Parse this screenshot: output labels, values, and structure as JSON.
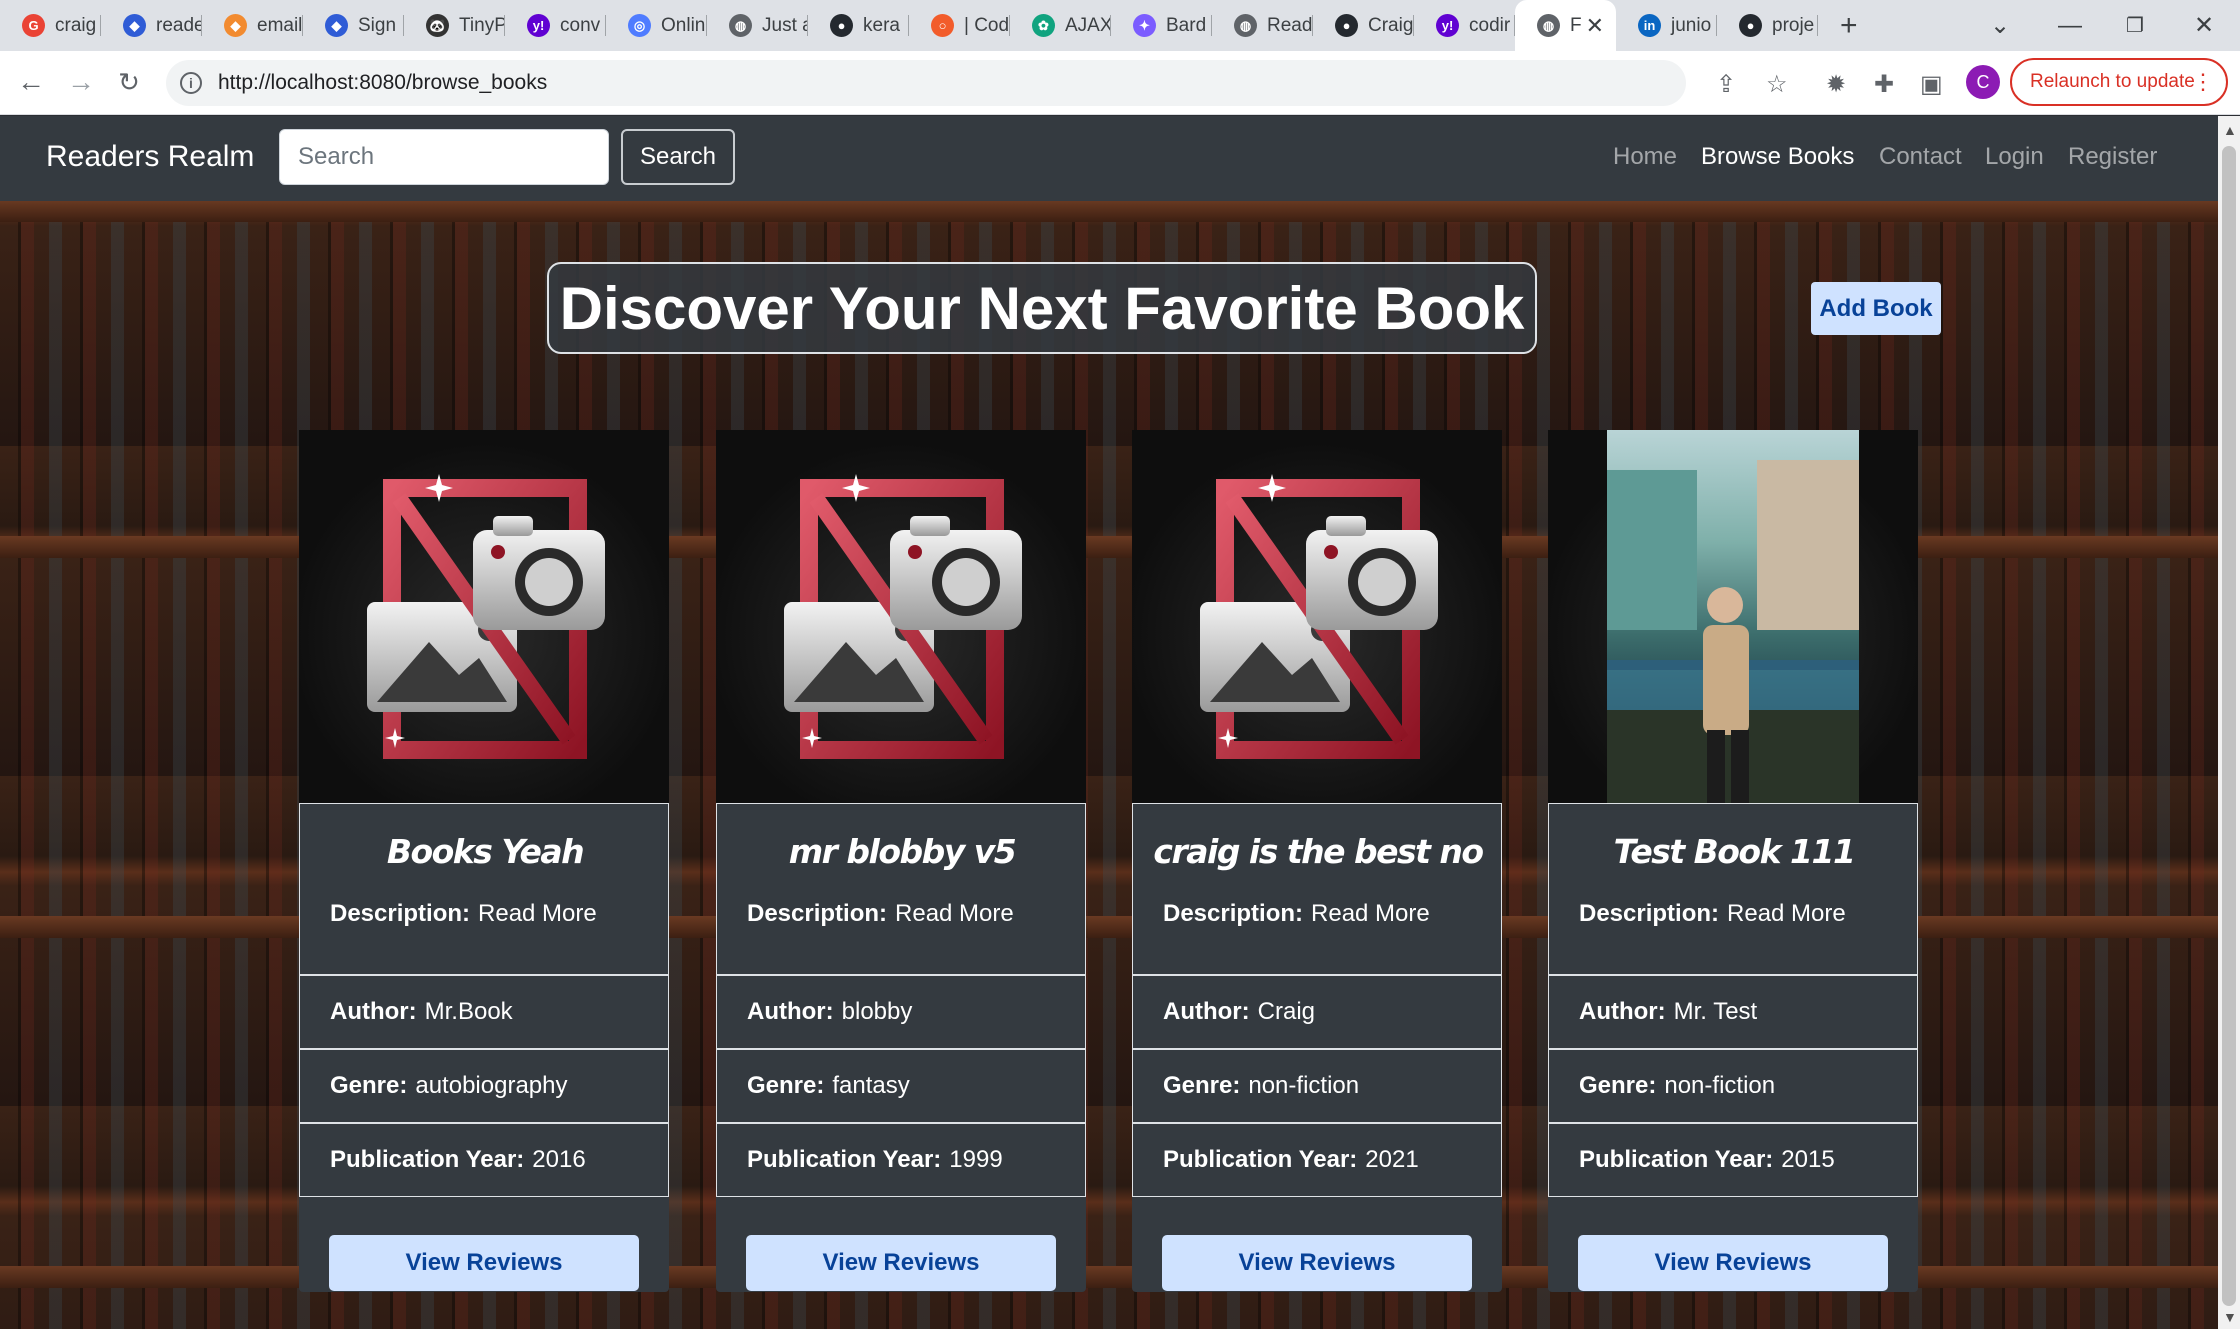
{
  "browser": {
    "tabs": [
      {
        "label": "craig",
        "fav_color": "#ea4335",
        "fav_glyph": "G"
      },
      {
        "label": "reade",
        "fav_color": "#2f5cd6",
        "fav_glyph": "◆"
      },
      {
        "label": "email",
        "fav_color": "#f28b30",
        "fav_glyph": "◆"
      },
      {
        "label": "Sign",
        "fav_color": "#2f5cd6",
        "fav_glyph": "◆"
      },
      {
        "label": "TinyP",
        "fav_color": "#333333",
        "fav_glyph": "🐼"
      },
      {
        "label": "conv",
        "fav_color": "#6001d2",
        "fav_glyph": "y!"
      },
      {
        "label": "Onlin",
        "fav_color": "#4f7cff",
        "fav_glyph": "◎"
      },
      {
        "label": "Just a",
        "fav_color": "#5f6368",
        "fav_glyph": "◍"
      },
      {
        "label": "kera",
        "fav_color": "#24292f",
        "fav_glyph": "●"
      },
      {
        "label": "| Cod",
        "fav_color": "#f25c2b",
        "fav_glyph": "○"
      },
      {
        "label": "AJAX",
        "fav_color": "#10a37f",
        "fav_glyph": "✿"
      },
      {
        "label": "Bard",
        "fav_color": "#7b5cff",
        "fav_glyph": "✦"
      },
      {
        "label": "Read",
        "fav_color": "#5f6368",
        "fav_glyph": "◍"
      },
      {
        "label": "Craig",
        "fav_color": "#24292f",
        "fav_glyph": "●"
      },
      {
        "label": "codir",
        "fav_color": "#6001d2",
        "fav_glyph": "y!"
      },
      {
        "label": "F",
        "fav_color": "#5f6368",
        "fav_glyph": "◍",
        "active": true
      },
      {
        "label": "junio",
        "fav_color": "#0a66c2",
        "fav_glyph": "in"
      },
      {
        "label": "proje",
        "fav_color": "#24292f",
        "fav_glyph": "●"
      }
    ],
    "url": "http://localhost:8080/browse_books",
    "relaunch_label": "Relaunch to update",
    "profile_initial": "C"
  },
  "site": {
    "brand": "Readers Realm",
    "search_placeholder": "Search",
    "search_button": "Search",
    "nav": {
      "home": "Home",
      "browse": "Browse Books",
      "contact": "Contact",
      "login": "Login",
      "register": "Register"
    },
    "hero_title": "Discover Your Next Favorite Book",
    "add_book": "Add Book"
  },
  "labels": {
    "description": "Description:",
    "read_more": "Read More",
    "author": "Author:",
    "genre": "Genre:",
    "year": "Publication Year:",
    "view_reviews": "View Reviews"
  },
  "books": [
    {
      "title": "Books Yeah",
      "author": "Mr.Book",
      "genre": "autobiography",
      "year": "2016",
      "image": "no-image-placeholder"
    },
    {
      "title": "mr blobby v5",
      "author": "blobby",
      "genre": "fantasy",
      "year": "1999",
      "image": "no-image-placeholder"
    },
    {
      "title": "craig is the best no",
      "author": "Craig",
      "genre": "non-fiction",
      "year": "2021",
      "image": "no-image-placeholder"
    },
    {
      "title": "Test Book 111",
      "author": "Mr. Test",
      "genre": "non-fiction",
      "year": "2015",
      "image": "photo-person-street"
    }
  ],
  "colors": {
    "navbar": "#343a40",
    "card": "#343a40",
    "button_bg": "#cfe2ff",
    "button_text": "#084298",
    "relaunch": "#d93025"
  }
}
